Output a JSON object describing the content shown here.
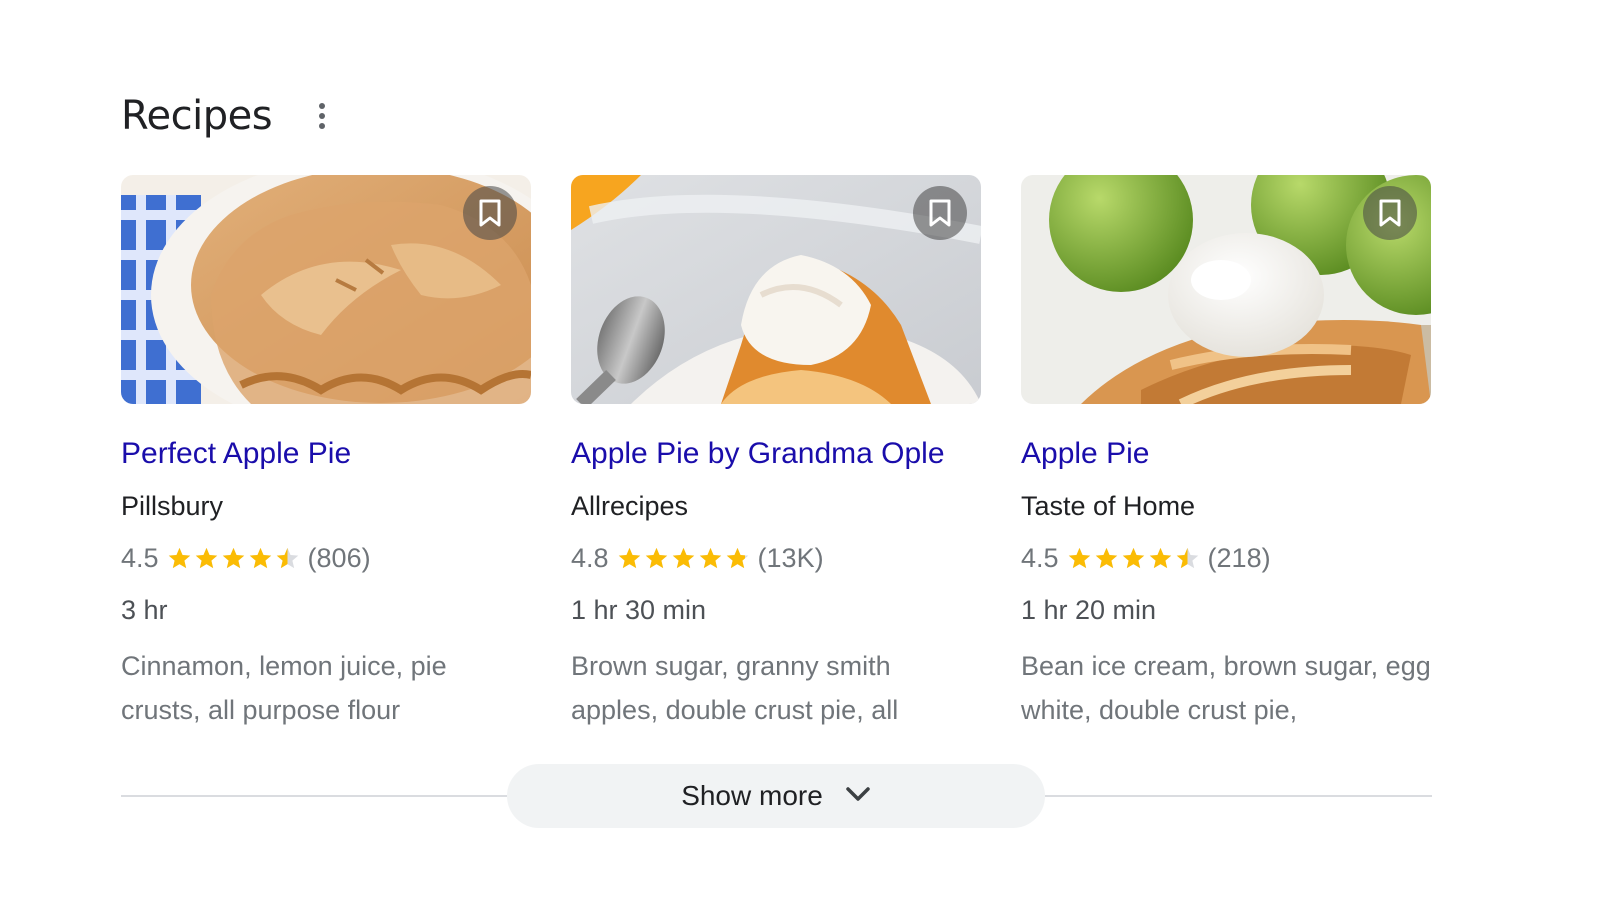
{
  "section": {
    "title": "Recipes"
  },
  "recipes": [
    {
      "title": "Perfect Apple Pie",
      "source": "Pillsbury",
      "rating": "4.5",
      "rating_value": 4.5,
      "reviews": "(806)",
      "time": "3 hr",
      "ingredients": "Cinnamon, lemon juice, pie crusts, all purpose flour"
    },
    {
      "title": "Apple Pie by Grandma Ople",
      "source": "Allrecipes",
      "rating": "4.8",
      "rating_value": 4.8,
      "reviews": "(13K)",
      "time": "1 hr 30 min",
      "ingredients": "Brown sugar, granny smith apples, double crust pie, all"
    },
    {
      "title": "Apple Pie",
      "source": "Taste of Home",
      "rating": "4.5",
      "rating_value": 4.5,
      "reviews": "(218)",
      "time": "1 hr 20 min",
      "ingredients": "Bean ice cream, brown sugar, egg white, double crust pie,"
    }
  ],
  "show_more": {
    "label": "Show more"
  },
  "colors": {
    "link": "#1a0dab",
    "star": "#fbbc04",
    "star_empty": "#dadce0",
    "button_bg": "#f1f3f4"
  },
  "icons": {
    "menu": "more-vert-icon",
    "bookmark": "bookmark-icon",
    "star": "star-icon",
    "chevron": "chevron-down-icon"
  }
}
